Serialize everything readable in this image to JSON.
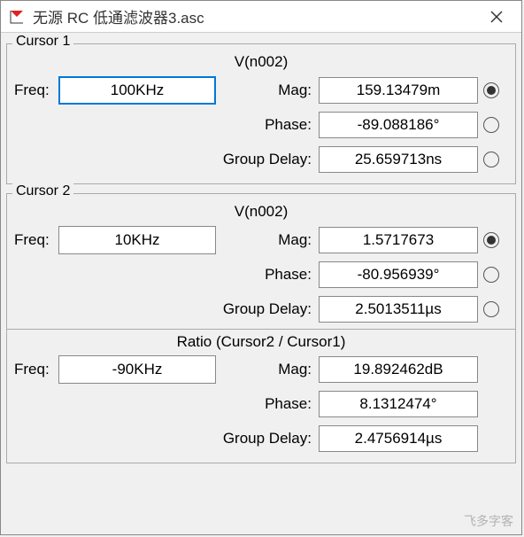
{
  "window": {
    "title": "无源 RC 低通滤波器3.asc"
  },
  "cursor1": {
    "group_label": "Cursor 1",
    "signal": "V(n002)",
    "freq_label": "Freq:",
    "freq_value": "100KHz",
    "mag_label": "Mag:",
    "mag_value": "159.13479m",
    "phase_label": "Phase:",
    "phase_value": "-89.088186°",
    "delay_label": "Group Delay:",
    "delay_value": "25.659713ns",
    "selected": "mag"
  },
  "cursor2": {
    "group_label": "Cursor 2",
    "signal": "V(n002)",
    "freq_label": "Freq:",
    "freq_value": "10KHz",
    "mag_label": "Mag:",
    "mag_value": "1.5717673",
    "phase_label": "Phase:",
    "phase_value": "-80.956939°",
    "delay_label": "Group Delay:",
    "delay_value": "2.5013511µs",
    "selected": "mag"
  },
  "ratio": {
    "title": "Ratio (Cursor2 / Cursor1)",
    "freq_label": "Freq:",
    "freq_value": "-90KHz",
    "mag_label": "Mag:",
    "mag_value": "19.892462dB",
    "phase_label": "Phase:",
    "phase_value": "8.1312474°",
    "delay_label": "Group Delay:",
    "delay_value": "2.4756914µs"
  },
  "watermark": "飞多字客"
}
